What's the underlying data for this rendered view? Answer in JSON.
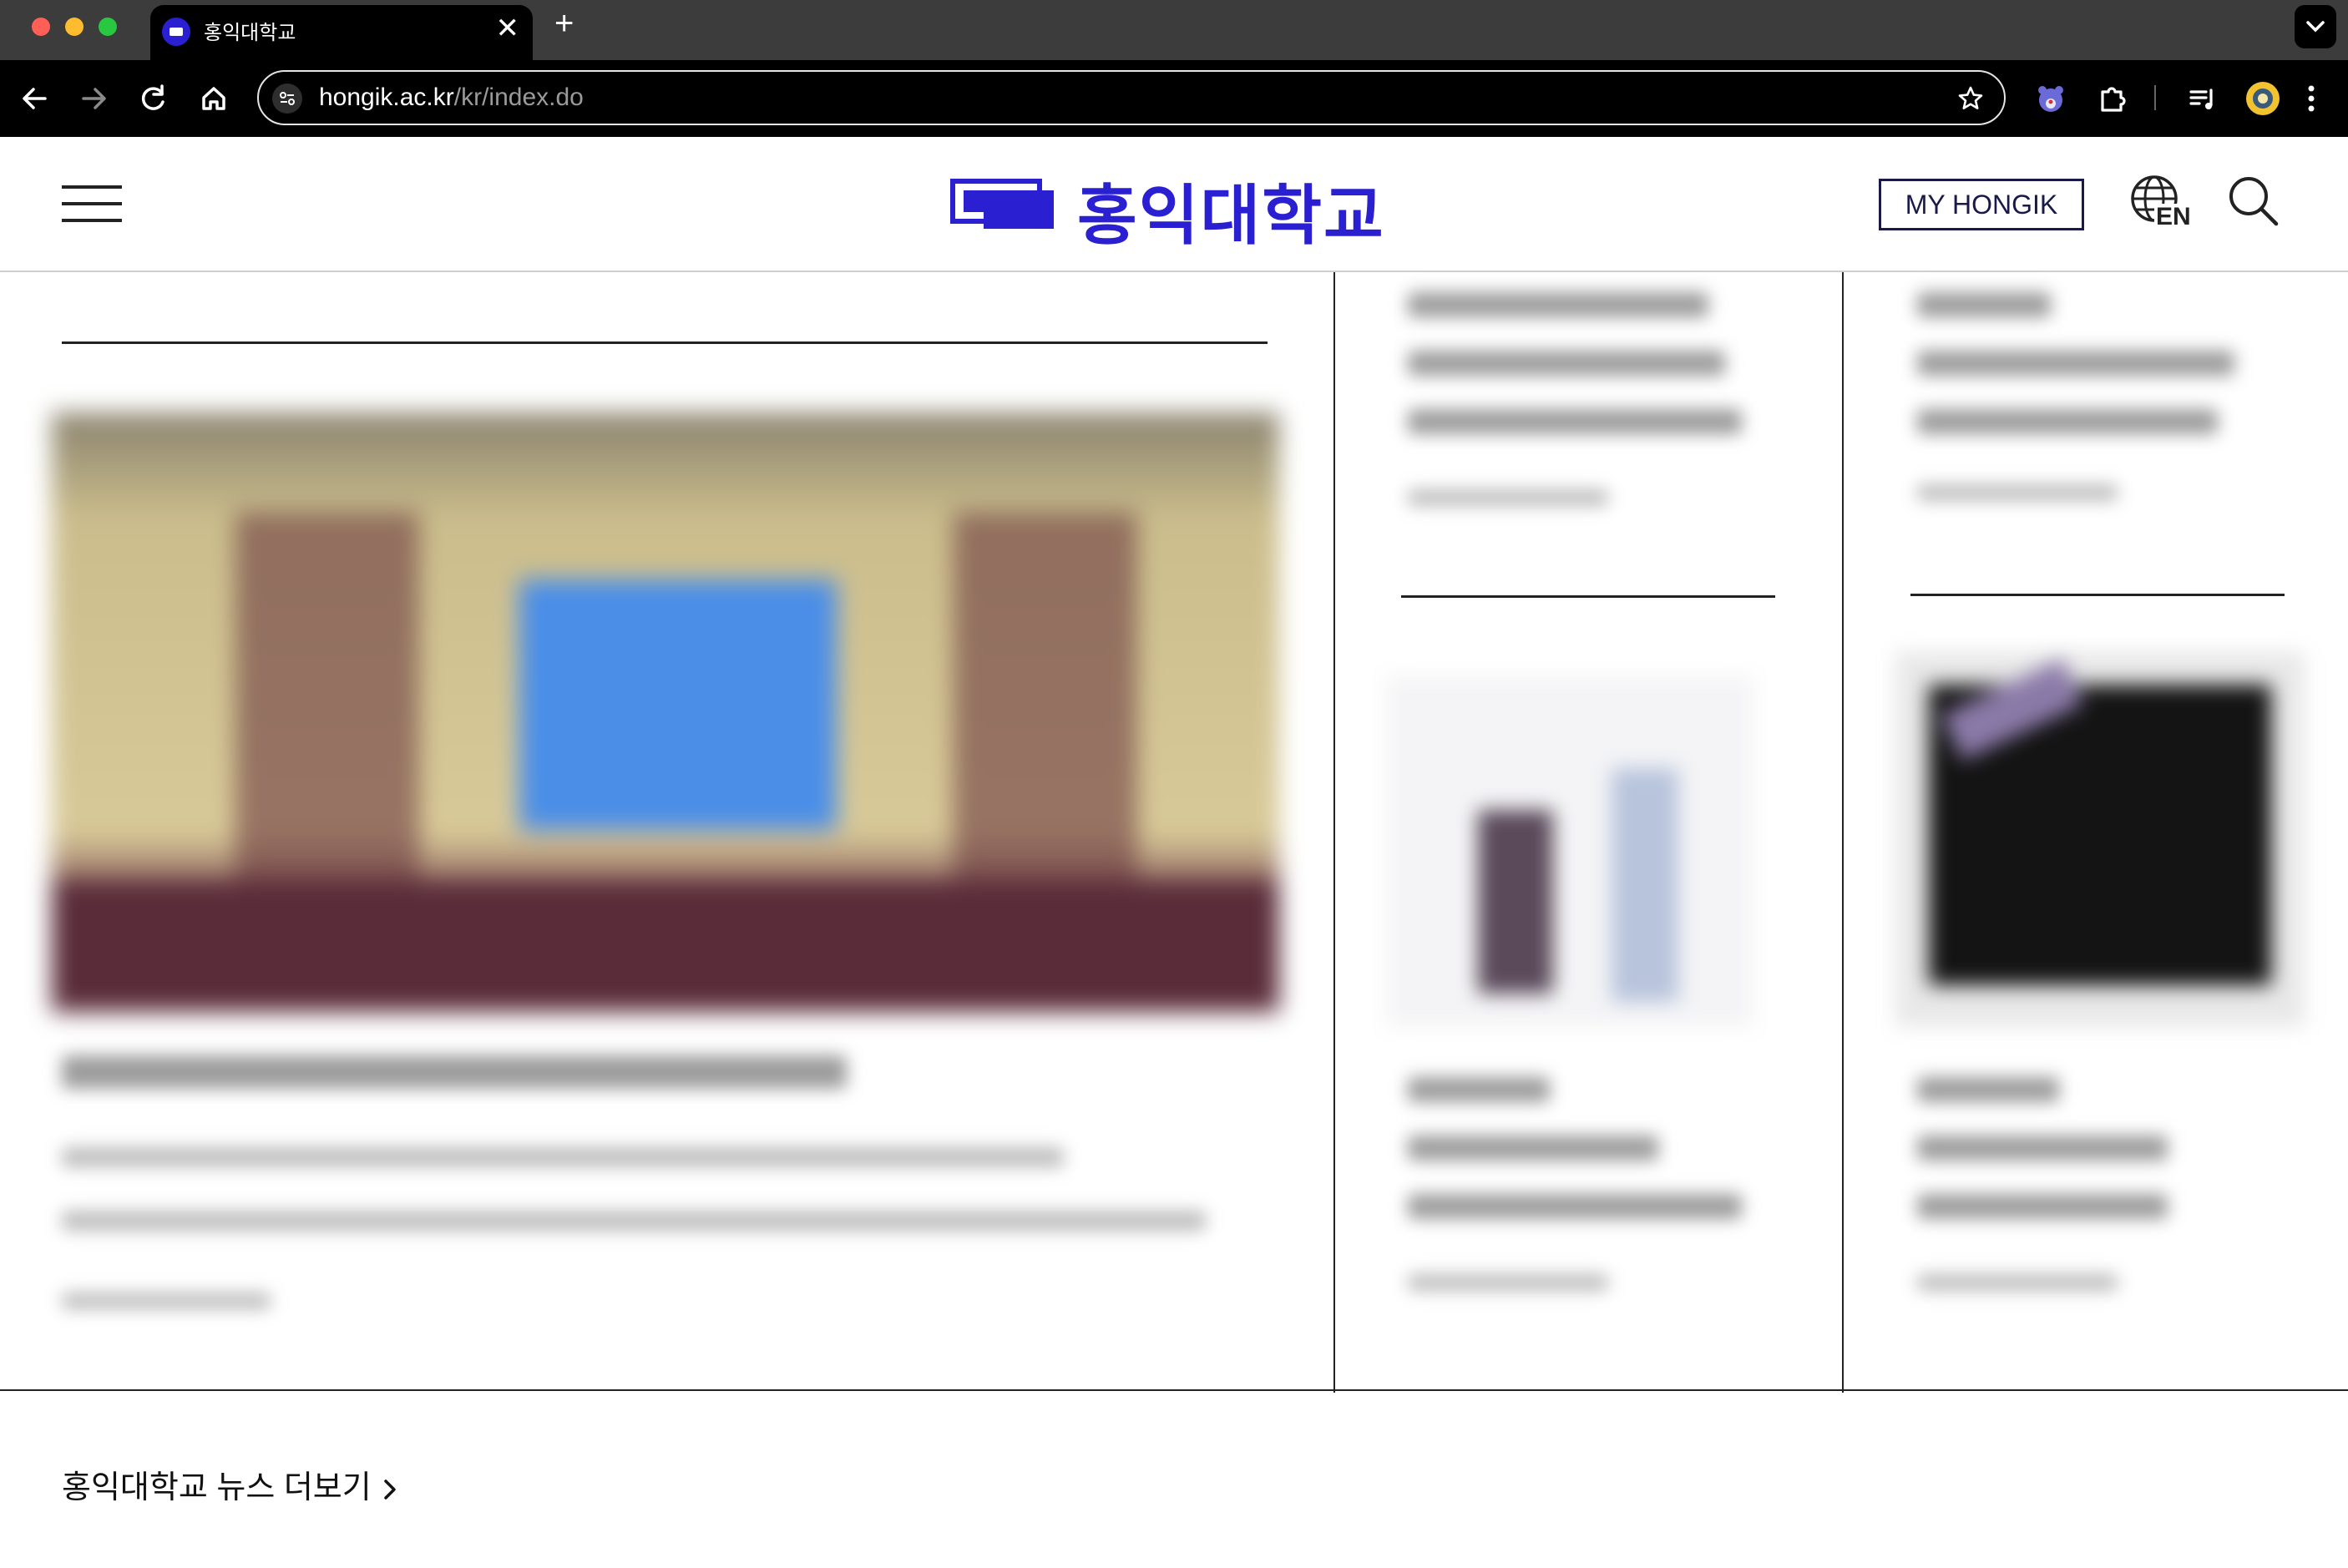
{
  "browser": {
    "tab": {
      "title": "홍익대학교",
      "close_glyph": "✕"
    },
    "new_tab_glyph": "+",
    "address_bar": {
      "host": "hongik.ac.kr",
      "path": "/kr/index.do"
    },
    "icons": [
      "back-arrow-icon",
      "forward-arrow-icon",
      "reload-icon",
      "home-icon",
      "site-settings-icon",
      "bookmark-star-icon",
      "extension-puzzle-icon",
      "media-queue-icon",
      "profile-avatar-icon",
      "kebab-menu-icon"
    ]
  },
  "site": {
    "logo_text": "홍익대학교",
    "brand_color": "#2a1fd1",
    "my_hongik_label": "MY HONGIK",
    "language_label": "EN",
    "more_news_label": "홍익대학교 뉴스 더보기"
  }
}
